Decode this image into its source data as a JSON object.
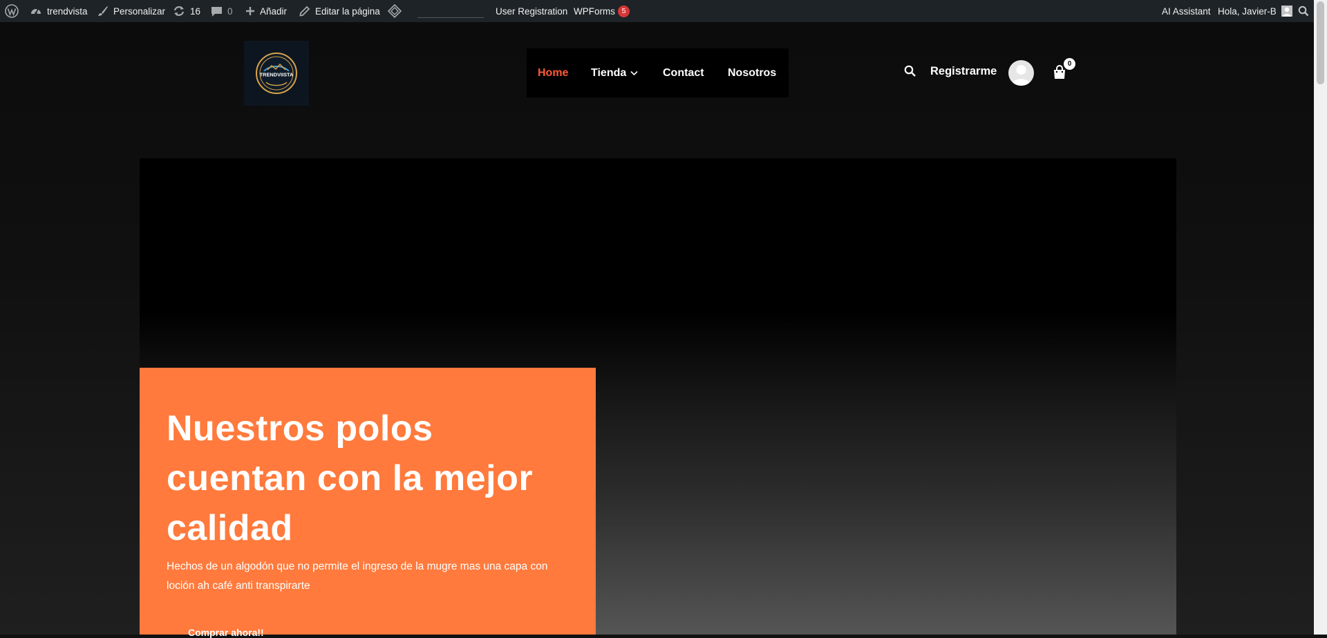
{
  "admin_bar": {
    "site_name": "trendvista",
    "customize": "Personalizar",
    "updates_count": "16",
    "comments_count": "0",
    "add_new": "Añadir",
    "edit_page": "Editar la página",
    "user_registration": "User Registration",
    "wpforms": "WPForms",
    "wpforms_badge": "5",
    "ai_assistant": "AI Assistant",
    "greeting": "Hola, Javier-B"
  },
  "header": {
    "logo_text": "TRENDVIISTA",
    "nav": [
      {
        "label": "Home",
        "active": true
      },
      {
        "label": "Tienda",
        "has_dropdown": true
      },
      {
        "label": "Contact"
      },
      {
        "label": "Nosotros"
      }
    ],
    "register": "Registrarme",
    "cart_count": "0"
  },
  "hero": {
    "title": "Nuestros polos cuentan con la mejor calidad",
    "text": "Hechos de un algodón que no permite el ingreso de la mugre mas una capa con loción ah café anti transpirarte",
    "button": "Comprar ahora!!"
  },
  "colors": {
    "admin_bar_bg": "#1d2327",
    "accent": "#ff5a36",
    "hero_card": "#ff7a3c",
    "badge": "#d63638"
  },
  "icons": [
    "wordpress-icon",
    "dashboard-icon",
    "brush-icon",
    "updates-icon",
    "comment-icon",
    "plus-icon",
    "pencil-icon",
    "diamond-icon",
    "admin-search-icon",
    "search-icon",
    "user-avatar-icon",
    "shopping-bag-icon",
    "chevron-down-icon"
  ]
}
